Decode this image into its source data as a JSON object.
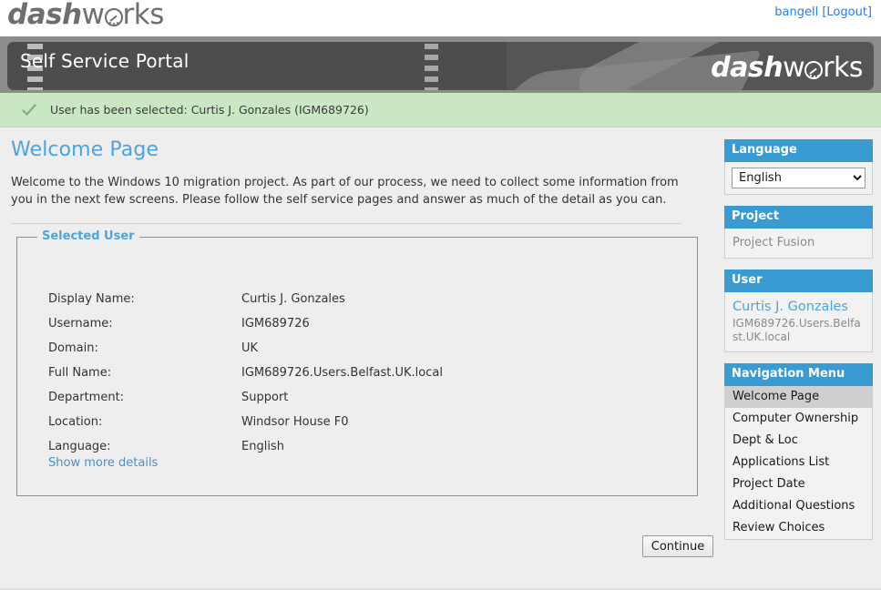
{
  "brand": {
    "logo_bold": "dash",
    "logo_rest_pre": "w",
    "logo_rest_post": "rks",
    "logo_icon": "speedometer-icon"
  },
  "topbar": {
    "username": "bangell",
    "logout_label": "[Logout]"
  },
  "banner": {
    "title": "Self Service Portal"
  },
  "notice": {
    "icon": "check-icon",
    "message": "User has been selected: Curtis J. Gonzales (IGM689726)"
  },
  "main": {
    "page_title": "Welcome Page",
    "intro": "Welcome to the Windows 10 migration project. As part of our process, we need to collect some information from you in the next few screens. Please follow the self service pages and answer as much of the detail as you can.",
    "fieldset_legend": "Selected User",
    "fields": [
      {
        "label": "Display Name:",
        "value": "Curtis J. Gonzales"
      },
      {
        "label": "Username:",
        "value": "IGM689726"
      },
      {
        "label": "Domain:",
        "value": "UK"
      },
      {
        "label": "Full Name:",
        "value": "IGM689726.Users.Belfast.UK.local"
      },
      {
        "label": "Department:",
        "value": "Support"
      },
      {
        "label": "Location:",
        "value": "Windsor House F0"
      },
      {
        "label": "Language:",
        "value": "English"
      }
    ],
    "show_more_label": "Show more details",
    "continue_label": "Continue"
  },
  "sidebar": {
    "language": {
      "header": "Language",
      "selected": "English",
      "options": [
        "English"
      ]
    },
    "project": {
      "header": "Project",
      "name": "Project Fusion"
    },
    "user": {
      "header": "User",
      "display_name": "Curtis J. Gonzales",
      "distinguished_name": "IGM689726.Users.Belfast.UK.local"
    },
    "navigation": {
      "header": "Navigation Menu",
      "items": [
        {
          "label": "Welcome Page",
          "active": true
        },
        {
          "label": "Computer Ownership",
          "active": false
        },
        {
          "label": "Dept & Loc",
          "active": false
        },
        {
          "label": "Applications List",
          "active": false
        },
        {
          "label": "Project Date",
          "active": false
        },
        {
          "label": "Additional Questions",
          "active": false
        },
        {
          "label": "Review Choices",
          "active": false
        }
      ]
    }
  },
  "colors": {
    "accent_blue": "#3a9bd2",
    "title_blue": "#4ea3dd",
    "link_blue": "#2b7fd4",
    "banner_dark": "#4d4d4d",
    "banner_outer": "#8c8c8c",
    "notice_green": "#c9e7c3",
    "page_bg": "#eeeeee"
  }
}
